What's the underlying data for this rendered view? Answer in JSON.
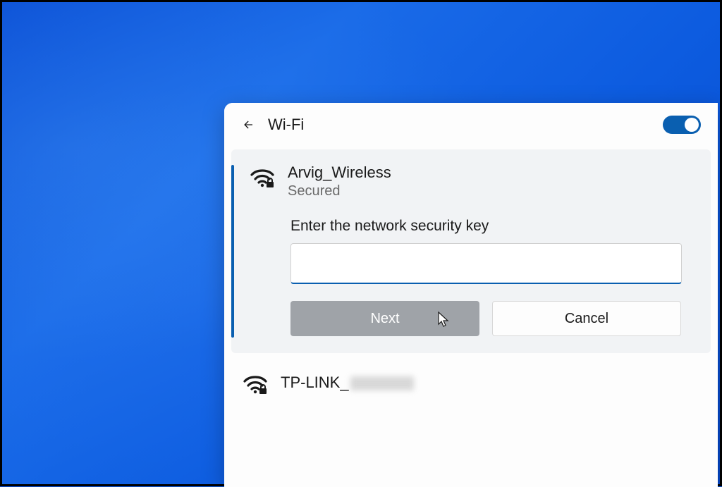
{
  "panel": {
    "title": "Wi-Fi",
    "toggle_on": true
  },
  "selected_network": {
    "name": "Arvig_Wireless",
    "status": "Secured",
    "prompt": "Enter the network security key",
    "password_value": "",
    "next_label": "Next",
    "cancel_label": "Cancel",
    "icon": "wifi-secured-icon"
  },
  "other_networks": [
    {
      "name": "TP-LINK_",
      "icon": "wifi-secured-icon"
    }
  ],
  "colors": {
    "accent": "#0a5fb0",
    "bg": "#0d5ce0"
  }
}
